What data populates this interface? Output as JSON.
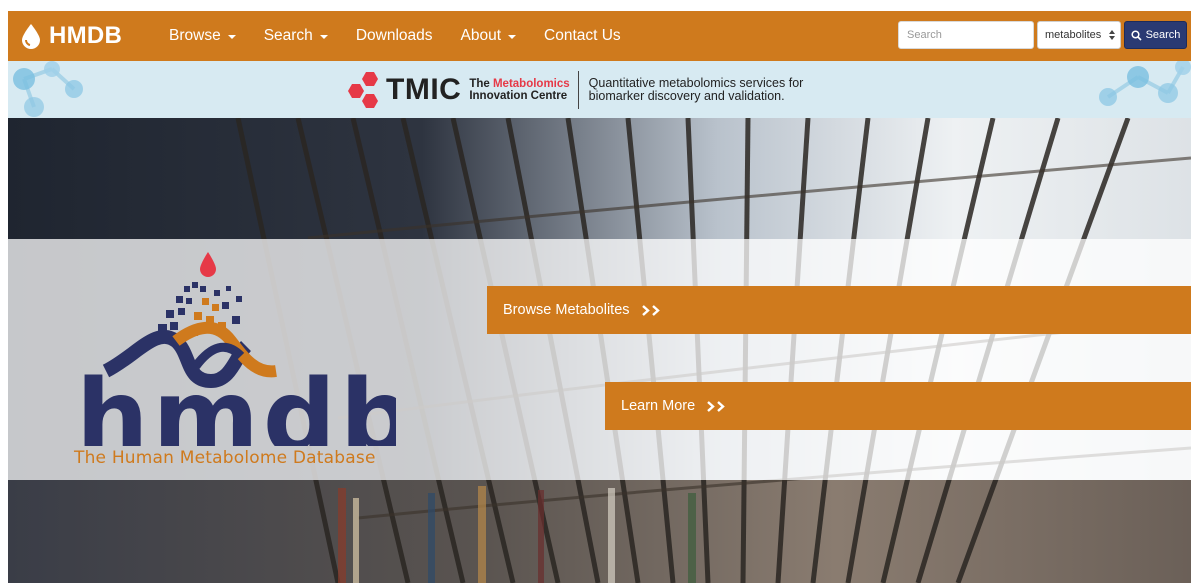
{
  "navbar": {
    "brand": "HMDB",
    "menu": [
      {
        "label": "Browse",
        "dropdown": true
      },
      {
        "label": "Search",
        "dropdown": true
      },
      {
        "label": "Downloads",
        "dropdown": false
      },
      {
        "label": "About",
        "dropdown": true
      },
      {
        "label": "Contact Us",
        "dropdown": false
      }
    ],
    "search": {
      "placeholder": "Search",
      "value": "",
      "select_value": "metabolites",
      "button_label": "Search"
    }
  },
  "banner": {
    "wordmark": "TMIC",
    "name_line1_prefix": "The ",
    "name_line1_highlight": "Metabolomics",
    "name_line2": "Innovation Centre",
    "tagline_line1": "Quantitative metabolomics services for",
    "tagline_line2": "biomarker discovery and validation."
  },
  "hero": {
    "browse_label": "Browse Metabolites",
    "learn_label": "Learn More",
    "logo_text": "hmdb",
    "logo_tagline": "The Human Metabolome Database"
  },
  "colors": {
    "brand_orange": "#cf7a1d",
    "navy": "#2a3a73",
    "banner_blue": "#d7eaf2",
    "tmic_red": "#e63947"
  },
  "icons": [
    "drop-icon",
    "caret-down-icon",
    "search-icon",
    "select-arrows-icon",
    "tmic-hexagon-logo",
    "chevron-right-icon"
  ]
}
